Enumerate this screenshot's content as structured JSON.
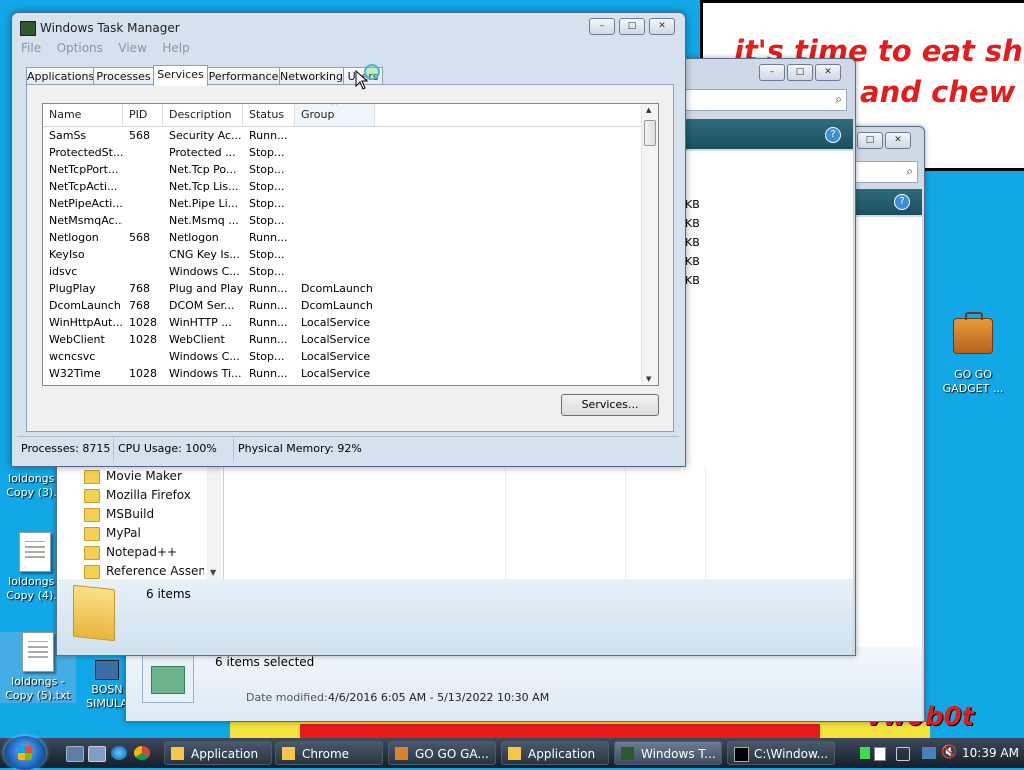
{
  "desktop": {
    "cloud_text_line1": "it's time to eat shit",
    "cloud_text_line2": "and chew",
    "bottom_text": "vw0b0t",
    "icons": [
      {
        "label_line1": "loldongs -",
        "label_line2": "Copy (3)..."
      },
      {
        "label_line1": "loldongs -",
        "label_line2": "Copy (4)..."
      },
      {
        "label_line1": "loldongs -",
        "label_line2": "Copy (5).txt"
      },
      {
        "label_line1": "BOSN",
        "label_line2": "SIMULA"
      },
      {
        "label_line1": "GO GO",
        "label_line2": "GADGET ..."
      }
    ]
  },
  "task_manager": {
    "title": "Windows Task Manager",
    "menu": [
      "File",
      "Options",
      "View",
      "Help"
    ],
    "tabs": [
      "Applications",
      "Processes",
      "Services",
      "Performance",
      "Networking",
      "Users"
    ],
    "active_tab": "Services",
    "columns": [
      "Name",
      "PID",
      "Description",
      "Status",
      "Group"
    ],
    "rows": [
      [
        "SamSs",
        "568",
        "Security Ac...",
        "Runn...",
        ""
      ],
      [
        "ProtectedSt...",
        "",
        "Protected ...",
        "Stop...",
        ""
      ],
      [
        "NetTcpPort...",
        "",
        "Net.Tcp Po...",
        "Stop...",
        ""
      ],
      [
        "NetTcpActi...",
        "",
        "Net.Tcp Lis...",
        "Stop...",
        ""
      ],
      [
        "NetPipeActi...",
        "",
        "Net.Pipe Li...",
        "Stop...",
        ""
      ],
      [
        "NetMsmqAc...",
        "",
        "Net.Msmq ...",
        "Stop...",
        ""
      ],
      [
        "Netlogon",
        "568",
        "Netlogon",
        "Runn...",
        ""
      ],
      [
        "KeyIso",
        "",
        "CNG Key Is...",
        "Stop...",
        ""
      ],
      [
        "idsvc",
        "",
        "Windows C...",
        "Stop...",
        ""
      ],
      [
        "PlugPlay",
        "768",
        "Plug and Play",
        "Runn...",
        "DcomLaunch"
      ],
      [
        "DcomLaunch",
        "768",
        "DCOM Ser...",
        "Runn...",
        "DcomLaunch"
      ],
      [
        "WinHttpAut...",
        "1028",
        "WinHTTP ...",
        "Runn...",
        "LocalService"
      ],
      [
        "WebClient",
        "1028",
        "WebClient",
        "Runn...",
        "LocalService"
      ],
      [
        "wcncsvc",
        "",
        "Windows C...",
        "Stop...",
        "LocalService"
      ],
      [
        "W32Time",
        "1028",
        "Windows Ti...",
        "Runn...",
        "LocalService"
      ]
    ],
    "services_button": "Services...",
    "status": {
      "processes": "Processes: 8715",
      "cpu": "CPU Usage: 100%",
      "memory": "Physical Memory: 92%"
    }
  },
  "explorer": {
    "tree_items": [
      "Movie Maker",
      "Mozilla Firefox",
      "MSBuild",
      "MyPal",
      "Notepad++",
      "Reference Assemb"
    ],
    "details_items": "6 items",
    "details_selected": "6 items selected",
    "date_modified_label": "Date modified:",
    "date_modified_value": "4/6/2016 6:05 AM - 5/13/2022 10:30 AM",
    "size_fragments": [
      "KB",
      "KB",
      "KB",
      "KB",
      "KB"
    ]
  },
  "taskbar": {
    "buttons": [
      "Application",
      "Chrome",
      "GO GO GA...",
      "Application",
      "Windows T...",
      "C:\\Window..."
    ],
    "clock": "10:39 AM"
  },
  "colors": {
    "desktop_blue": "#12a7e6",
    "cloud_text_red": "#e41c1c"
  }
}
